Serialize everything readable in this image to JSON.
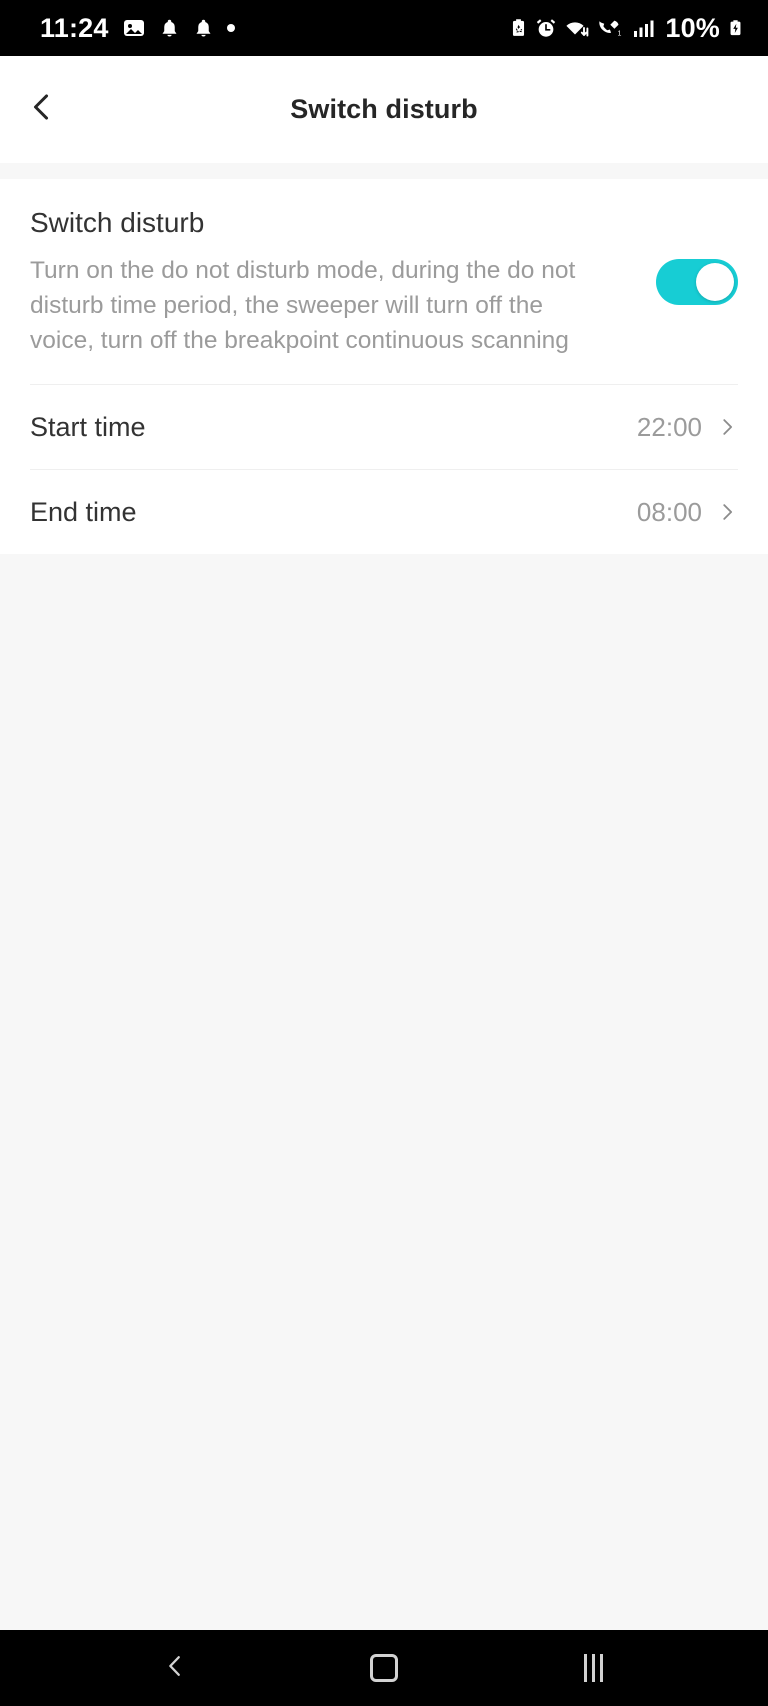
{
  "status_bar": {
    "time": "11:24",
    "battery_percent": "10%",
    "left_icons": [
      "image-icon",
      "bell-icon",
      "bell-icon",
      "dot-icon"
    ],
    "right_icons": [
      "battery-saver-icon",
      "alarm-icon",
      "wifi-data-icon",
      "wifi-calling-icon",
      "signal-bars-icon"
    ],
    "battery_state_icon": "battery-charging-icon",
    "background_color": "#000000",
    "foreground_color": "#ffffff"
  },
  "app_bar": {
    "back_icon": "chevron-left-icon",
    "title": "Switch disturb"
  },
  "main": {
    "switch_row": {
      "title": "Switch disturb",
      "description": "Turn on the do not disturb mode, during the do not disturb time period, the sweeper will turn off the voice, turn off the breakpoint continuous scanning",
      "toggle_state": "on",
      "toggle_color": "#17cdd4"
    },
    "rows": [
      {
        "label": "Start time",
        "value": "22:00",
        "chevron_icon": "chevron-right-icon"
      },
      {
        "label": "End time",
        "value": "08:00",
        "chevron_icon": "chevron-right-icon"
      }
    ]
  },
  "nav_bar": {
    "back_icon": "chevron-left-icon",
    "home_icon": "home-square-icon",
    "recents_icon": "recents-bars-icon",
    "background_color": "#000000"
  },
  "colors": {
    "page_background": "#f7f7f7",
    "card_background": "#ffffff",
    "primary_text": "#333333",
    "secondary_text": "#9b9b9b",
    "accent": "#17cdd4"
  }
}
